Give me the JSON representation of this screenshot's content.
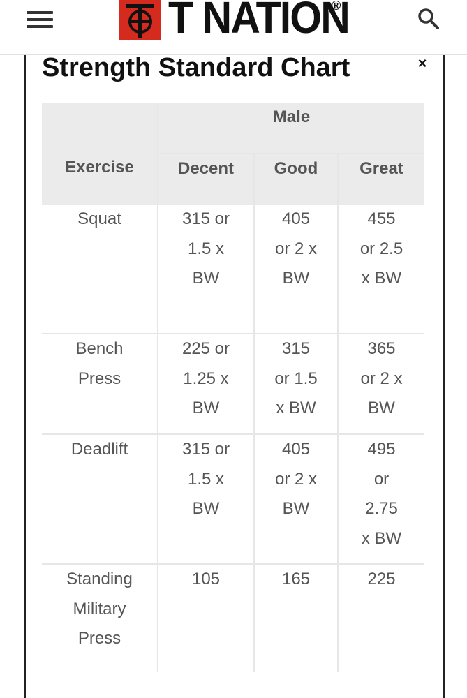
{
  "header": {
    "logo_text": "T NATION",
    "logo_registered": "®",
    "menu_icon": "hamburger-menu-icon",
    "search_icon": "search-icon",
    "brand_color": "#d52b1e"
  },
  "modal": {
    "title": "Strength Standard Chart",
    "close_label": "×"
  },
  "table": {
    "group_header": "Male",
    "columns": [
      "Exercise",
      "Decent",
      "Good",
      "Great"
    ],
    "rows": [
      {
        "exercise": [
          "Squat"
        ],
        "decent": [
          "315 or",
          "1.5 x",
          "BW"
        ],
        "good": [
          "405",
          "or 2 x",
          "BW"
        ],
        "great": [
          "455",
          "or 2.5",
          "x BW"
        ]
      },
      {
        "exercise": [
          "Bench",
          "Press"
        ],
        "decent": [
          "225 or",
          "1.25 x",
          "BW"
        ],
        "good": [
          "315",
          "or 1.5",
          "x BW"
        ],
        "great": [
          "365",
          "or 2 x",
          "BW"
        ]
      },
      {
        "exercise": [
          "Deadlift"
        ],
        "decent": [
          "315 or",
          "1.5 x",
          "BW"
        ],
        "good": [
          "405",
          "or 2 x",
          "BW"
        ],
        "great": [
          "495",
          "or",
          "2.75",
          "x BW"
        ]
      },
      {
        "exercise": [
          "Standing",
          "Military",
          "Press"
        ],
        "decent": [
          "105"
        ],
        "good": [
          "165"
        ],
        "great": [
          "225"
        ]
      }
    ]
  }
}
